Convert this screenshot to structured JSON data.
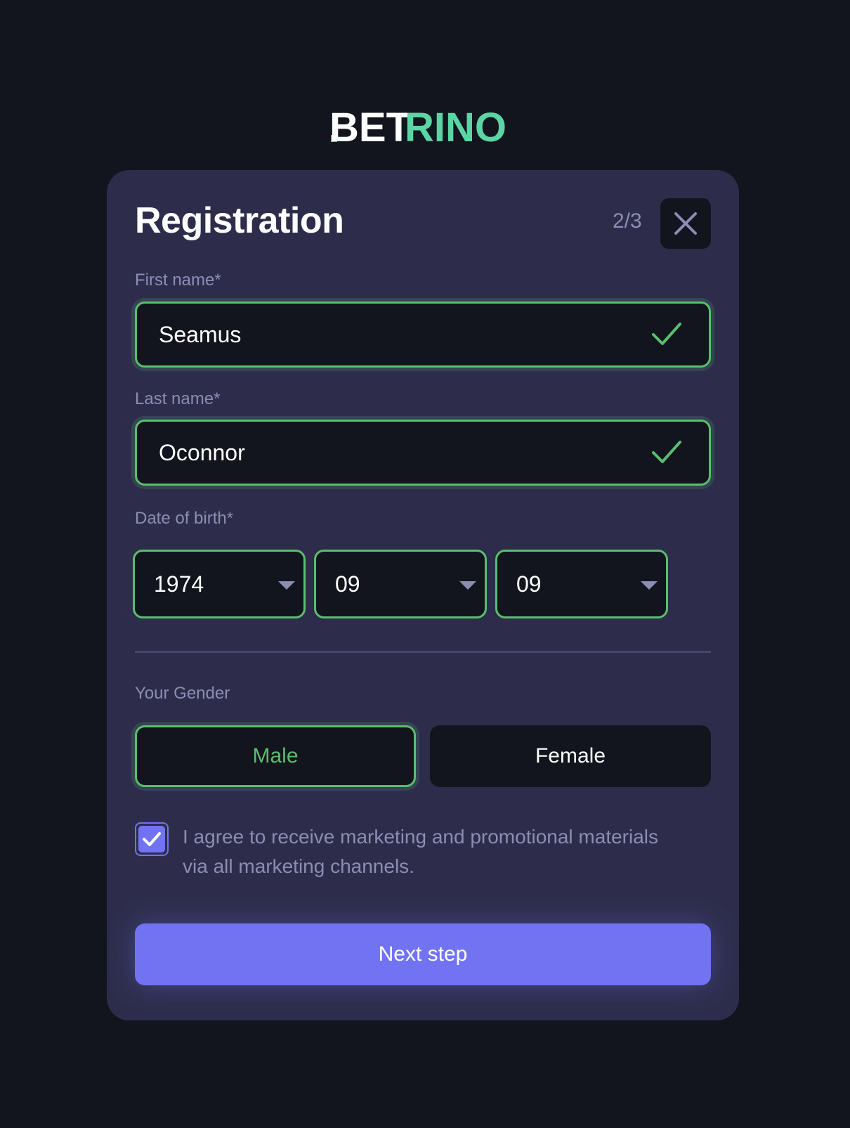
{
  "brand": {
    "logo_text": "BETRINO",
    "logo_part1": "BET",
    "logo_part2": "RINO",
    "accent_color": "#5bd5a4"
  },
  "modal": {
    "title": "Registration",
    "step": "2/3",
    "close_icon": "close-icon"
  },
  "form": {
    "first_name": {
      "label": "First name*",
      "value": "Seamus",
      "status": "valid"
    },
    "last_name": {
      "label": "Last name*",
      "value": "Oconnor",
      "status": "valid"
    },
    "date_of_birth": {
      "label": "Date of birth*",
      "year": "1974",
      "month": "09",
      "day": "09"
    },
    "gender": {
      "label": "Your Gender",
      "options": [
        "Male",
        "Female"
      ],
      "selected": "Male"
    },
    "marketing_consent": {
      "checked": true,
      "text": "I agree to receive marketing and promotional materials via all marketing channels."
    }
  },
  "actions": {
    "next_label": "Next step"
  },
  "colors": {
    "background": "#12151e",
    "card": "#2d2d4b",
    "valid": "#5bbd6d",
    "primary": "#7173f3",
    "muted_text": "#8b8db3"
  }
}
